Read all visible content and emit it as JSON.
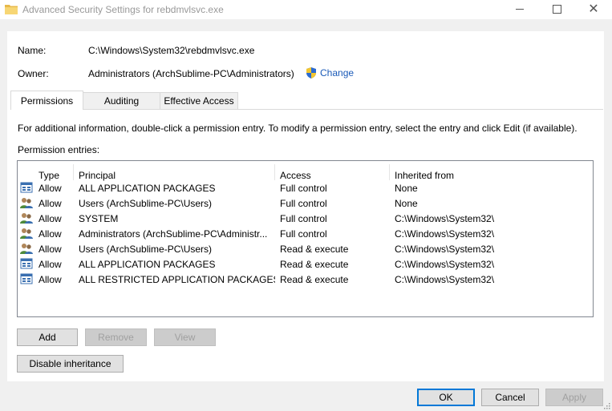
{
  "window": {
    "title": "Advanced Security Settings for rebdmvlsvc.exe",
    "controls": {
      "minimize_icon": "minimize-icon",
      "maximize_icon": "maximize-icon",
      "close": "✕"
    }
  },
  "header": {
    "name_label": "Name:",
    "name_value": "C:\\Windows\\System32\\rebdmvlsvc.exe",
    "owner_label": "Owner:",
    "owner_value": "Administrators (ArchSublime-PC\\Administrators)",
    "change_link": "Change"
  },
  "tabs": [
    {
      "label": "Permissions",
      "active": true
    },
    {
      "label": "Auditing",
      "active": false
    },
    {
      "label": "Effective Access",
      "active": false
    }
  ],
  "permissions": {
    "info_text": "For additional information, double-click a permission entry. To modify a permission entry, select the entry and click Edit (if available).",
    "entries_label": "Permission entries:",
    "columns": [
      "Type",
      "Principal",
      "Access",
      "Inherited from"
    ],
    "rows": [
      {
        "icon": "package-icon",
        "type": "Allow",
        "principal": "ALL APPLICATION PACKAGES",
        "access": "Full control",
        "inherited": "None"
      },
      {
        "icon": "users-icon",
        "type": "Allow",
        "principal": "Users (ArchSublime-PC\\Users)",
        "access": "Full control",
        "inherited": "None"
      },
      {
        "icon": "users-icon",
        "type": "Allow",
        "principal": "SYSTEM",
        "access": "Full control",
        "inherited": "C:\\Windows\\System32\\"
      },
      {
        "icon": "users-icon",
        "type": "Allow",
        "principal": "Administrators (ArchSublime-PC\\Administr...",
        "access": "Full control",
        "inherited": "C:\\Windows\\System32\\"
      },
      {
        "icon": "users-icon",
        "type": "Allow",
        "principal": "Users (ArchSublime-PC\\Users)",
        "access": "Read & execute",
        "inherited": "C:\\Windows\\System32\\"
      },
      {
        "icon": "package-icon",
        "type": "Allow",
        "principal": "ALL APPLICATION PACKAGES",
        "access": "Read & execute",
        "inherited": "C:\\Windows\\System32\\"
      },
      {
        "icon": "package-icon",
        "type": "Allow",
        "principal": "ALL RESTRICTED APPLICATION PACKAGES",
        "access": "Read & execute",
        "inherited": "C:\\Windows\\System32\\"
      }
    ],
    "buttons": {
      "add": "Add",
      "remove": "Remove",
      "view": "View"
    },
    "disable_inheritance": "Disable inheritance"
  },
  "footer": {
    "ok": "OK",
    "cancel": "Cancel",
    "apply": "Apply"
  },
  "colors": {
    "link": "#1a5ab8",
    "accent": "#0078d7",
    "background": "#f0f0f0"
  }
}
